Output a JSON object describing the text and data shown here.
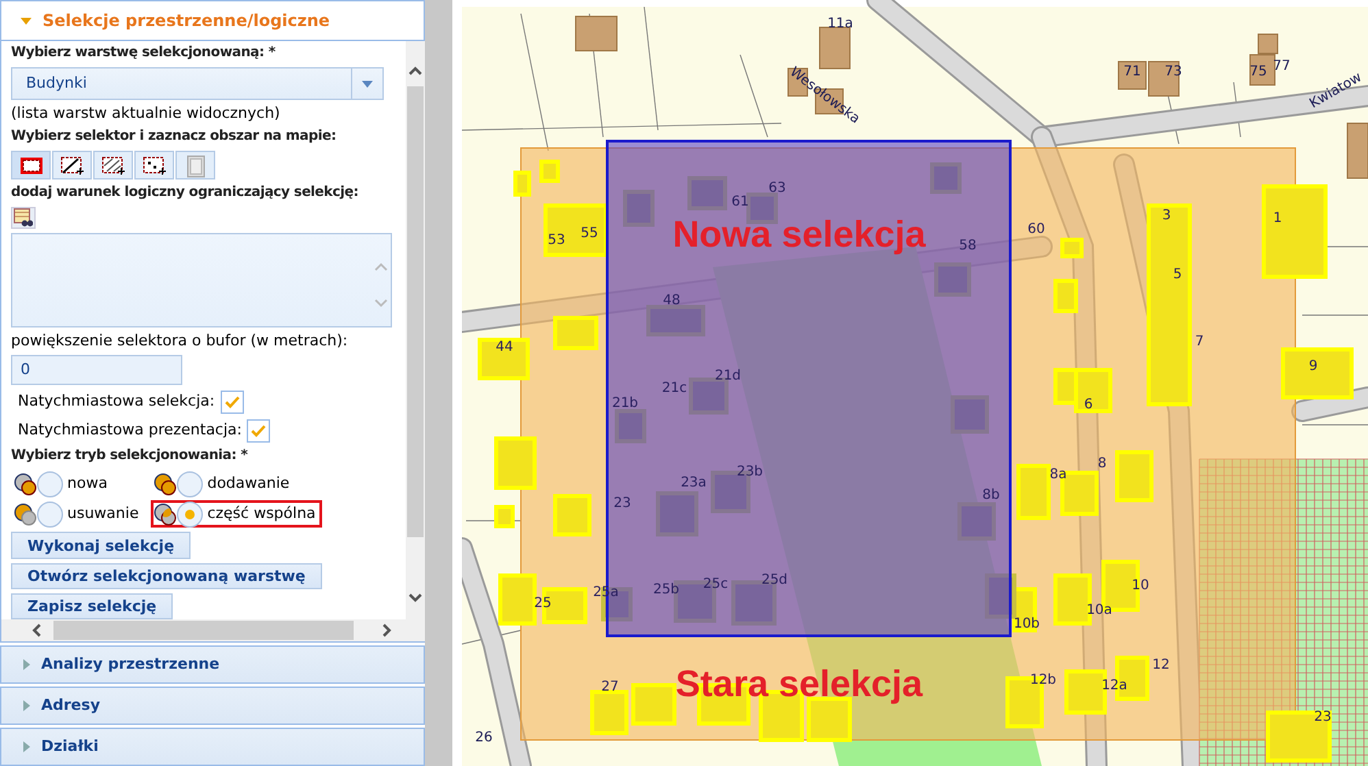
{
  "panel": {
    "title": "Selekcje przestrzenne/logiczne",
    "expanded": true,
    "layer_label": "Wybierz warstwę selekcjonowaną: *",
    "layer_value": "Budynki",
    "layer_hint": "(lista warstw aktualnie widocznych)",
    "selector_label": "Wybierz selektor i zaznacz obszar na mapie:",
    "selectors": [
      {
        "selected": true
      },
      {
        "selected": false
      },
      {
        "selected": false
      },
      {
        "selected": false
      },
      {
        "selected": false
      }
    ],
    "condition_label": "dodaj warunek logiczny ograniczający selekcję:",
    "buffer_label": "powiększenie selektora o bufor (w metrach):",
    "buffer_value": "0",
    "options": [
      {
        "label": "Natychmiastowa selekcja:",
        "checked": true
      },
      {
        "label": "Natychmiastowa prezentacja:",
        "checked": true
      }
    ],
    "mode_label": "Wybierz tryb selekcjonowania: *",
    "modes": [
      {
        "label": "nowa",
        "selected": false,
        "highlighted": false
      },
      {
        "label": "dodawanie",
        "selected": false,
        "highlighted": false
      },
      {
        "label": "usuwanie",
        "selected": false,
        "highlighted": false
      },
      {
        "label": "część wspólna",
        "selected": true,
        "highlighted": true
      }
    ],
    "buttons": [
      "Wykonaj selekcję",
      "Otwórz selekcjonowaną warstwę",
      "Zapisz selekcję"
    ]
  },
  "sections": [
    {
      "title": "Analizy przestrzenne",
      "expanded": false
    },
    {
      "title": "Adresy",
      "expanded": false
    },
    {
      "title": "Działki",
      "expanded": false
    }
  ],
  "map": {
    "streets": [
      "Wesołowska",
      "Kwiatow"
    ],
    "house_numbers": [
      "11a",
      "71",
      "73",
      "75",
      "77",
      "53",
      "55",
      "61",
      "63",
      "60",
      "58",
      "48",
      "44",
      "3",
      "5",
      "7",
      "1",
      "9",
      "21b",
      "21c",
      "21d",
      "23",
      "23a",
      "23b",
      "25",
      "25a",
      "25b",
      "25c",
      "25d",
      "8a",
      "8",
      "8b",
      "6",
      "10",
      "10a",
      "10b",
      "12",
      "27",
      "12b",
      "12a",
      "26",
      "23"
    ],
    "annotations": [
      "Nowa selekcja",
      "Stara selekcja"
    ]
  }
}
